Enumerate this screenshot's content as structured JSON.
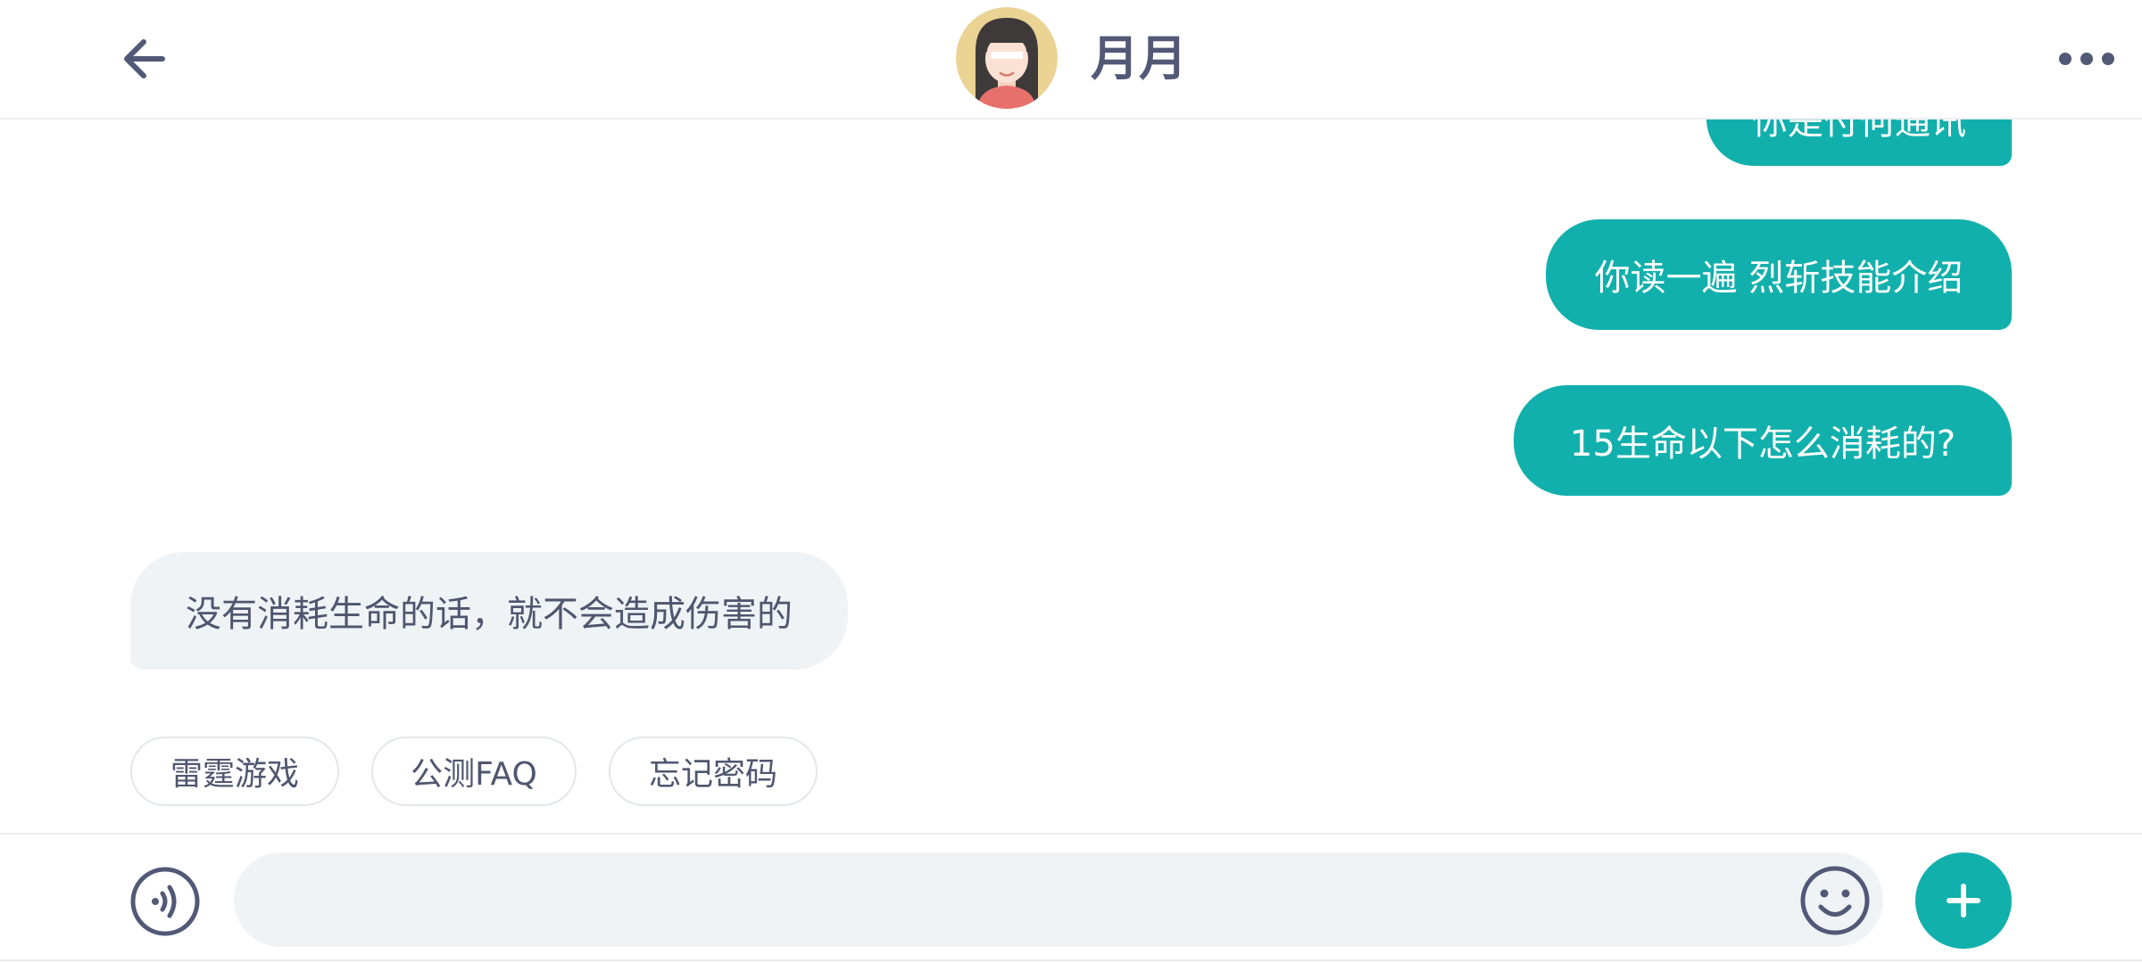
{
  "header": {
    "contact_name": "月月",
    "back_icon": "arrow-left-icon",
    "more_icon": "more-dots-icon",
    "avatar_icon": "girl-avatar-icon"
  },
  "messages": [
    {
      "sender": "me",
      "text": "你是付何通讯"
    },
    {
      "sender": "me",
      "text": "你读一遍 烈斩技能介绍"
    },
    {
      "sender": "me",
      "text": "15生命以下怎么消耗的?"
    },
    {
      "sender": "contact",
      "text": "没有消耗生命的话，就不会造成伤害的"
    }
  ],
  "quick_replies": [
    "雷霆游戏",
    "公测FAQ",
    "忘记密码"
  ],
  "input_bar": {
    "value": "",
    "placeholder": "",
    "voice_icon": "voice-input-icon",
    "emoji_icon": "emoji-icon",
    "plus_icon": "plus-icon"
  },
  "colors": {
    "accent": "#12b0ac",
    "text_primary": "#525977",
    "bubble_incoming": "#f0f3f6"
  }
}
